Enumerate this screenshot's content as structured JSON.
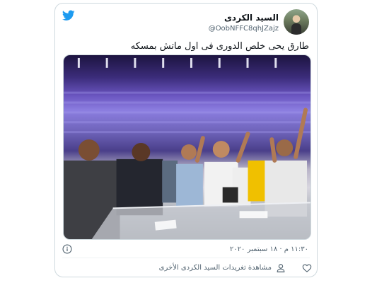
{
  "tweet": {
    "author_name": "السيد الكردى",
    "author_handle": "@OobNFFC8qhJZajz",
    "text": "طارق يحى خلص الدورى فى اول ماتش بمسكه",
    "timestamp": "١١:٣٠ م · ١٨ سبتمبر ٢٠٢٠",
    "more_tweets_link": "مشاهدة تغريدات السيد الكردى الأخرى"
  },
  "icons": {
    "brand": "twitter-bird-icon",
    "info": "info-icon",
    "like": "heart-icon",
    "profile": "person-icon"
  },
  "colors": {
    "twitter_blue": "#1d9bf0",
    "text_primary": "#0f1419",
    "text_secondary": "#536471"
  }
}
